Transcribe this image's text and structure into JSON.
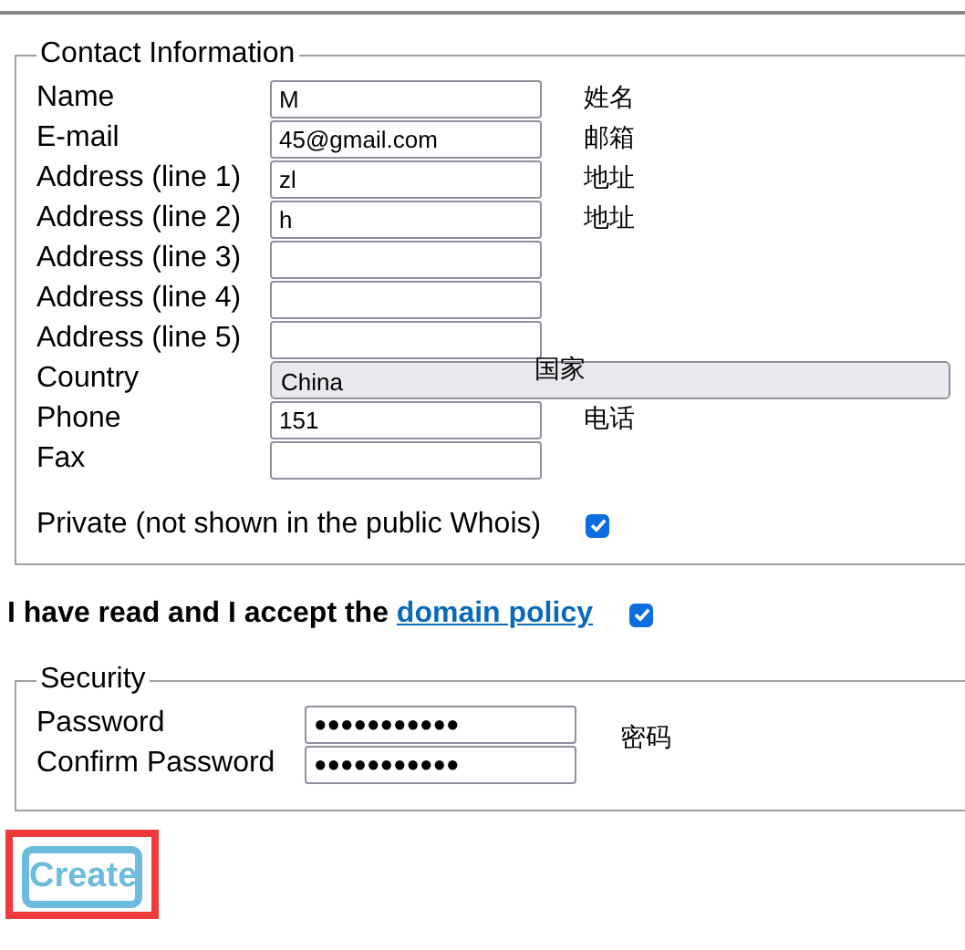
{
  "contact": {
    "legend": "Contact Information",
    "fields": [
      {
        "kind": "text",
        "label": "Name",
        "value": "M",
        "annotation": "姓名"
      },
      {
        "kind": "text",
        "label": "E-mail",
        "value": "45@gmail.com",
        "annotation": "邮箱"
      },
      {
        "kind": "text",
        "label": "Address (line 1)",
        "value": "zl",
        "annotation": "地址"
      },
      {
        "kind": "text",
        "label": "Address (line 2)",
        "value": "h",
        "annotation": "地址"
      },
      {
        "kind": "text",
        "label": "Address (line 3)"
      },
      {
        "kind": "text",
        "label": "Address (line 4)"
      },
      {
        "kind": "text",
        "label": "Address (line 5)"
      },
      {
        "kind": "select",
        "label": "Country",
        "value": "China",
        "annotation": "国家"
      },
      {
        "kind": "text",
        "label": "Phone",
        "value": "151",
        "annotation": "电话"
      },
      {
        "kind": "text",
        "label": "Fax"
      }
    ],
    "private": {
      "label": "Private (not shown in the public Whois)",
      "checked": true
    }
  },
  "policy": {
    "text": "I have read and I accept the ",
    "link": "domain policy",
    "checked": true
  },
  "security": {
    "legend": "Security",
    "fields": [
      {
        "label": "Password",
        "value": "●●●●●●●●●●●",
        "annotation": "密码"
      },
      {
        "label": "Confirm Password",
        "value": "●●●●●●●●●●●"
      }
    ]
  },
  "create_button": {
    "label": "Create",
    "highlighted": true
  }
}
